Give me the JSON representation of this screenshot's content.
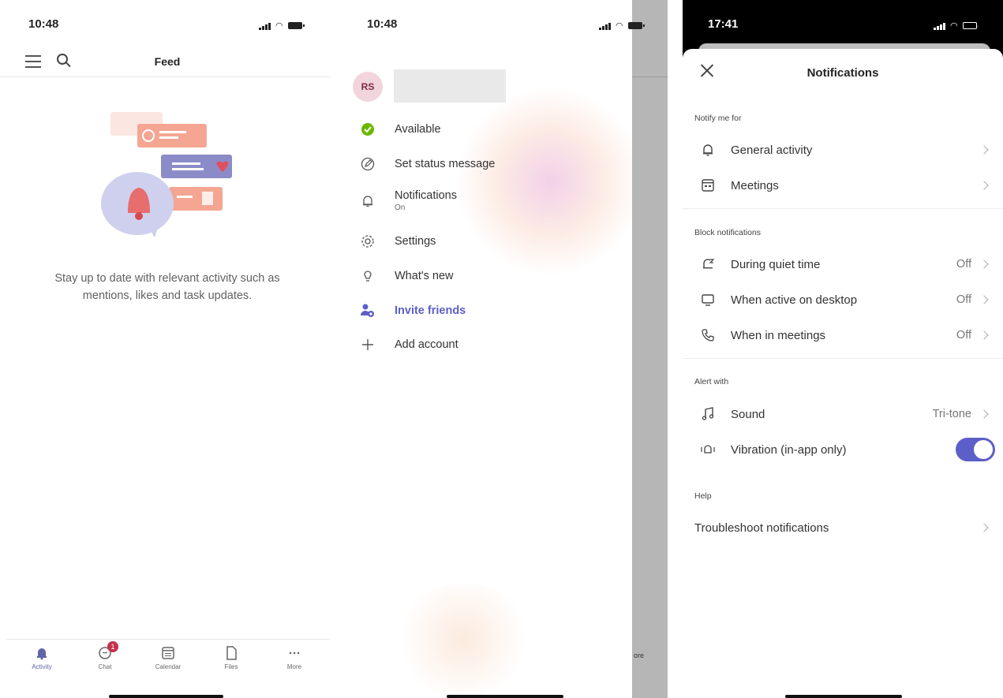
{
  "panel1": {
    "time": "10:48",
    "title": "Feed",
    "empty_message": "Stay up to date with relevant activity such as mentions, likes and task updates.",
    "tabs": [
      {
        "label": "Activity",
        "icon": "bell-icon",
        "active": true
      },
      {
        "label": "Chat",
        "icon": "chat-icon",
        "badge": "1"
      },
      {
        "label": "Calendar",
        "icon": "calendar-icon"
      },
      {
        "label": "Files",
        "icon": "file-icon"
      },
      {
        "label": "More",
        "icon": "more-icon"
      }
    ]
  },
  "panel2": {
    "time": "10:48",
    "avatar_initials": "RS",
    "menu": [
      {
        "label": "Available",
        "icon": "available-status-icon"
      },
      {
        "label": "Set status message",
        "icon": "edit-status-icon"
      },
      {
        "label": "Notifications",
        "sub": "On",
        "icon": "bell-icon"
      },
      {
        "label": "Settings",
        "icon": "gear-icon"
      },
      {
        "label": "What's new",
        "icon": "lightbulb-icon"
      },
      {
        "label": "Invite friends",
        "icon": "invite-people-icon"
      },
      {
        "label": "Add account",
        "icon": "plus-icon"
      }
    ],
    "background_more_label": "ore"
  },
  "panel3": {
    "time": "17:41",
    "title": "Notifications",
    "sections": {
      "notify": "Notify me for",
      "block": "Block notifications",
      "alert": "Alert with",
      "help": "Help"
    },
    "rows": {
      "general": {
        "label": "General activity",
        "icon": "bell-icon"
      },
      "meetings": {
        "label": "Meetings",
        "icon": "calendar-icon"
      },
      "quiet": {
        "label": "During quiet time",
        "value": "Off",
        "icon": "quiet-time-bell-icon"
      },
      "desktop": {
        "label": "When active on desktop",
        "value": "Off",
        "icon": "desktop-icon"
      },
      "in_meetings": {
        "label": "When in meetings",
        "value": "Off",
        "icon": "phone-icon"
      },
      "sound": {
        "label": "Sound",
        "value": "Tri-tone",
        "icon": "music-note-icon"
      },
      "vibration": {
        "label": "Vibration (in-app only)",
        "icon": "vibration-icon",
        "enabled": true
      },
      "troubleshoot": {
        "label": "Troubleshoot notifications"
      }
    },
    "accent": "#5b5fc7"
  }
}
